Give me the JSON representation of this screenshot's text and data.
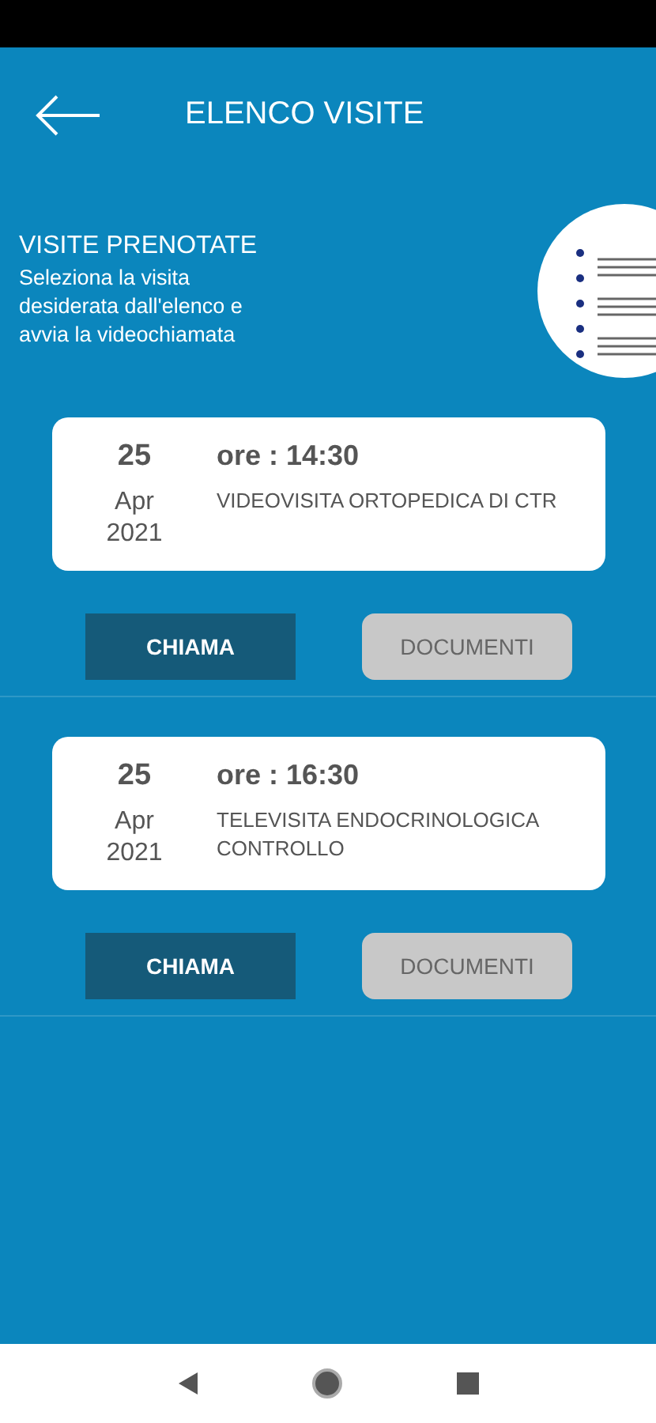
{
  "header": {
    "title": "ELENCO VISITE"
  },
  "intro": {
    "title": "VISITE PRENOTATE",
    "text": "Seleziona la visita desiderata dall'elenco e avvia la videochiamata"
  },
  "visits": [
    {
      "day": "25",
      "month": "Apr",
      "year": "2021",
      "time": "ore : 14:30",
      "description": "VIDEOVISITA ORTOPEDICA DI CTR",
      "call_label": "CHIAMA",
      "documents_label": "DOCUMENTI"
    },
    {
      "day": "25",
      "month": "Apr",
      "year": "2021",
      "time": "ore : 16:30",
      "description": "TELEVISITA ENDOCRINOLOGICA CONTROLLO",
      "call_label": "CHIAMA",
      "documents_label": "DOCUMENTI"
    }
  ]
}
